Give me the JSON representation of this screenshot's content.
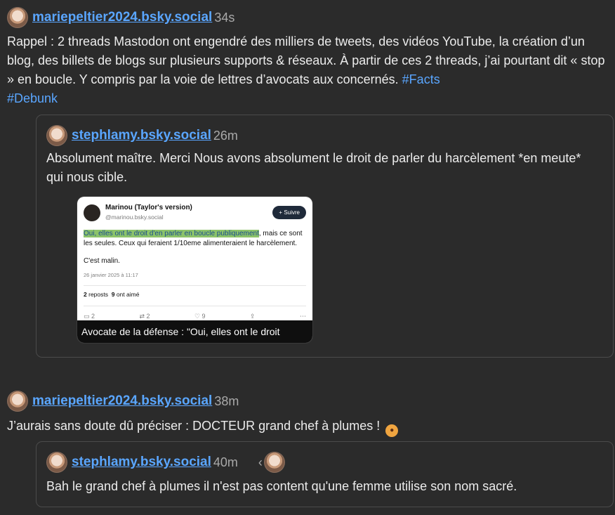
{
  "posts": [
    {
      "author": "mariepeltier2024.bsky.social",
      "time": "34s",
      "text": "Rappel : 2 threads Mastodon ont engendré des milliers de tweets, des vidéos YouTube, la création d’un blog, des billets de blogs sur plusieurs supports & réseaux. À partir de ces 2 threads, j’ai pourtant dit « stop » en boucle. Y compris par la voie de lettres d’avocats aux concernés.",
      "tags": [
        "#Facts",
        "#Debunk"
      ],
      "quote": {
        "author": "stephlamy.bsky.social",
        "time": "26m",
        "text": "Absolument maître. Merci Nous avons absolument le droit de parler du harcèlement *en meute* qui nous cible.",
        "embed": {
          "name": "Marinou (Taylor's version)",
          "handle": "@marinou.bsky.social",
          "follow_label": "+ Suivre",
          "highlight": "Oui, elles ont le droit d'en parler en boucle publiquement",
          "rest": ", mais ce sont les seules. Ceux qui feraient 1/10eme alimenteraient le harcèlement.",
          "line2": "C'est malin.",
          "date": "26 janvier 2025 à 11:17",
          "reposts": "2",
          "reposts_label": "reposts",
          "likes": "9",
          "likes_label": "ont aimé",
          "actions": {
            "reply": "2",
            "repost": "2",
            "like": "9"
          },
          "caption": "Avocate de la défense : \"Oui, elles ont le droit"
        }
      }
    },
    {
      "author": "mariepeltier2024.bsky.social",
      "time": "38m",
      "text": "J’aurais sans doute dû préciser : DOCTEUR grand chef à plumes !",
      "quote": {
        "author": "stephlamy.bsky.social",
        "time": "40m",
        "chevron": "‹",
        "text": "Bah le grand chef à plumes il n'est pas content qu'une femme utilise son nom sacré."
      }
    }
  ]
}
